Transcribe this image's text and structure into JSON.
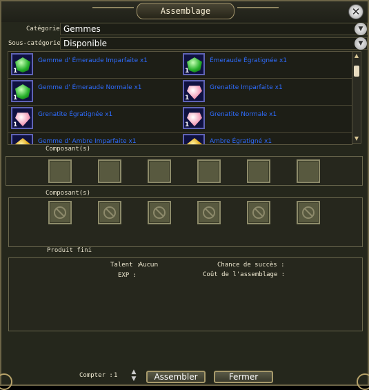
{
  "window": {
    "title": "Assemblage",
    "close_label": "✕"
  },
  "filters": {
    "category_label": "Catégorie",
    "category_value": "Gemmes",
    "subcategory_label": "Sous-catégorie",
    "subcategory_value": "Disponible"
  },
  "items": [
    {
      "name": "Gemme d' Émeraude Imparfaite x1",
      "gem": "green",
      "qty": "1"
    },
    {
      "name": "Émeraude Égratignée x1",
      "gem": "green",
      "qty": "1"
    },
    {
      "name": "Gemme d' Émeraude Normale x1",
      "gem": "green",
      "qty": "1"
    },
    {
      "name": "Grenatite Imparfaite x1",
      "gem": "pink",
      "qty": "1"
    },
    {
      "name": "Grenatite Égratignée x1",
      "gem": "pink",
      "qty": "1"
    },
    {
      "name": "Grenatite Normale x1",
      "gem": "pink",
      "qty": "1"
    },
    {
      "name": "Gemme d' Ambre Imparfaite x1",
      "gem": "amber",
      "qty": "1"
    },
    {
      "name": "Ambre Égratigné x1",
      "gem": "amber",
      "qty": "1"
    }
  ],
  "components1": {
    "label": "Composant(s)"
  },
  "components2": {
    "label": "Composant(s)"
  },
  "product": {
    "label": "Produit fini",
    "talent_label": "Talent :",
    "talent_value": "Aucun",
    "exp_label": "EXP :",
    "chance_label": "Chance de succès :",
    "cost_label": "Coût de l'assemblage :"
  },
  "footer": {
    "count_label": "Compter :",
    "count_value": "1",
    "assemble_button": "Assembler",
    "close_button": "Fermer"
  },
  "icons": {
    "close": "close-icon",
    "dropdown": "chevron-down-icon",
    "forbidden": "forbidden-icon"
  },
  "colors": {
    "item_text": "#2e6cff",
    "frame": "#6d6547"
  }
}
